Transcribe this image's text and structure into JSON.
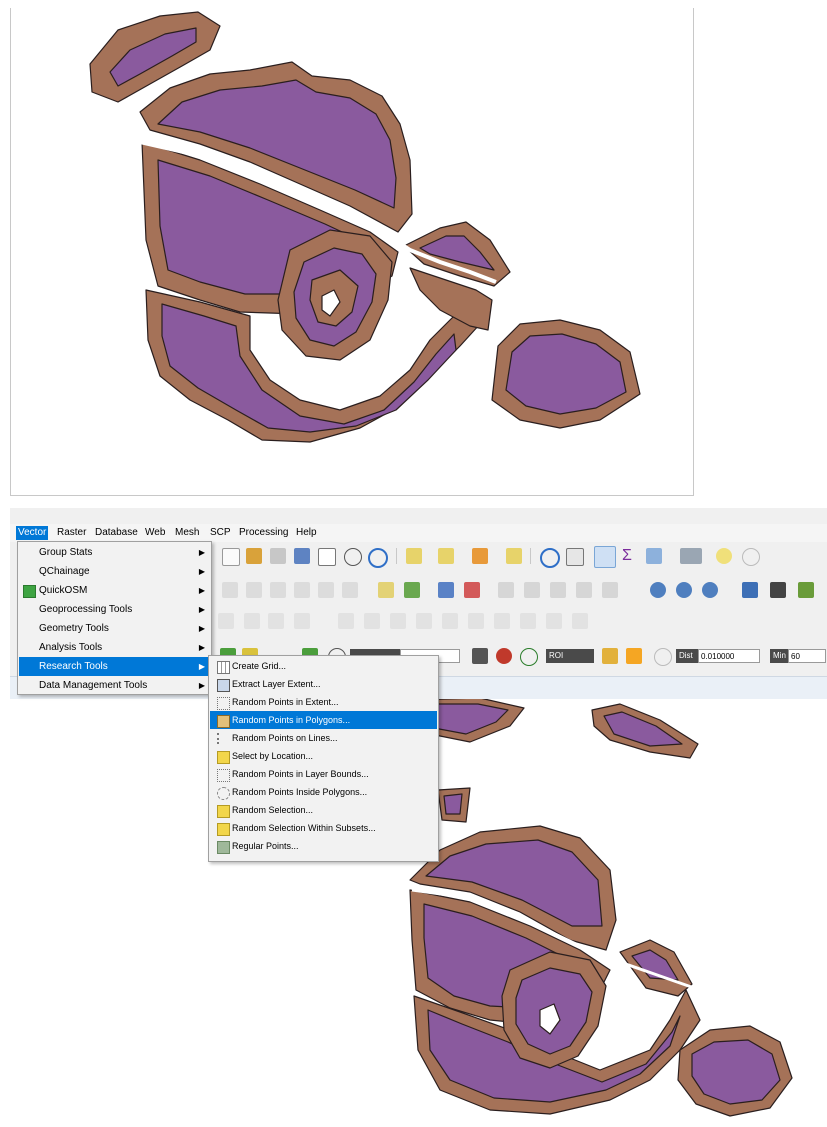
{
  "menubar": {
    "items": [
      "Vector",
      "Raster",
      "Database",
      "Web",
      "Mesh",
      "SCP",
      "Processing",
      "Help"
    ],
    "active": "Vector"
  },
  "vector_menu": {
    "items": [
      {
        "label": "Group Stats",
        "submenu": true,
        "icon": "none"
      },
      {
        "label": "QChainage",
        "submenu": true,
        "icon": "none"
      },
      {
        "label": "QuickOSM",
        "submenu": true,
        "icon": "quickosm-icon"
      },
      {
        "label": "Geoprocessing Tools",
        "submenu": true,
        "icon": "none"
      },
      {
        "label": "Geometry Tools",
        "submenu": true,
        "icon": "none"
      },
      {
        "label": "Analysis Tools",
        "submenu": true,
        "icon": "none"
      },
      {
        "label": "Research Tools",
        "submenu": true,
        "icon": "none",
        "selected": true
      },
      {
        "label": "Data Management Tools",
        "submenu": true,
        "icon": "none"
      }
    ]
  },
  "research_menu": {
    "items": [
      {
        "label": "Create Grid...",
        "icon": "grid-icon"
      },
      {
        "label": "Extract Layer Extent...",
        "icon": "extent-icon"
      },
      {
        "label": "Random Points in Extent...",
        "icon": "random-points-icon"
      },
      {
        "label": "Random Points in Polygons...",
        "icon": "random-points-polygon-icon",
        "selected": true
      },
      {
        "label": "Random Points on Lines...",
        "icon": "random-points-line-icon"
      },
      {
        "label": "Select by Location...",
        "icon": "select-location-icon"
      },
      {
        "label": "Random Points in Layer Bounds...",
        "icon": "random-points-bounds-icon"
      },
      {
        "label": "Random Points Inside Polygons...",
        "icon": "random-points-inside-icon"
      },
      {
        "label": "Random Selection...",
        "icon": "random-selection-icon"
      },
      {
        "label": "Random Selection Within Subsets...",
        "icon": "random-selection-subsets-icon"
      },
      {
        "label": "Regular Points...",
        "icon": "regular-points-icon"
      }
    ]
  },
  "scp_toolbar": {
    "roi_label": "ROI",
    "dist_label": "Dist",
    "dist_value": "0.010000",
    "min_label": "Min",
    "min_value": "60"
  },
  "colors": {
    "polygon_fill": "#8a5a9e",
    "polygon_border": "#a57258",
    "outline": "#2a1e1e",
    "highlight": "#0078d7",
    "menu_bg": "#f2f2f2"
  }
}
